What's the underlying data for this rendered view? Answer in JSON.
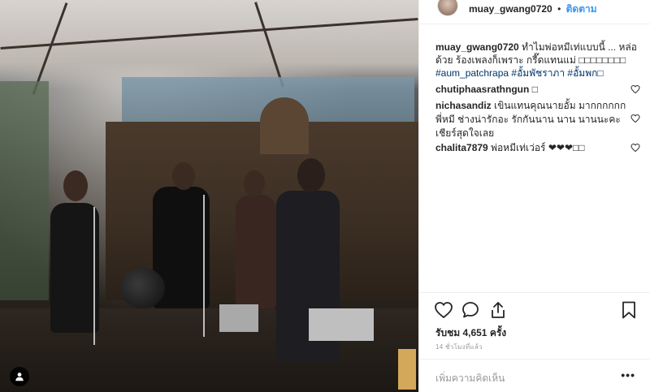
{
  "post": {
    "username": "muay_gwang0720",
    "separator": "•",
    "follow_label": "ติดตาม",
    "caption_text": "ทำไมพ่อหมีเท่แบบนี้ ... หล่อด้วย ร้องเพลงก็เพราะ กรี๊ดแทนแม่ □□□□□□□□",
    "caption_tags": "#aum_patchrapa #อั้มพัชราภา #อั้มพก□"
  },
  "comments": [
    {
      "username": "chutiphaasrathngun",
      "text": "□"
    },
    {
      "username": "nichasandiz",
      "text": "เขินแทนคุณนายอั้ม มากกกกกก พี่หมี ช่างน่ารักอะ รักกันนาน นาน นานนะคะ เชียร์สุดใจเลย"
    },
    {
      "username": "chalita7879",
      "text": "พ่อหมีเท่เว่อร์ ❤❤❤□□"
    }
  ],
  "stats": {
    "views": "รับชม 4,651 ครั้ง",
    "time_ago": "14 ชั่วโมงที่แล้ว"
  },
  "add_comment": {
    "placeholder": "เพิ่มความคิดเห็น"
  },
  "more_label": "•••",
  "icons": {
    "like": "heart-icon",
    "comment": "comment-icon",
    "share": "share-icon",
    "save": "bookmark-icon",
    "user_tag": "user-icon"
  },
  "colors": {
    "link_blue": "#3897f0",
    "hashtag_blue": "#003569",
    "muted": "#999999"
  }
}
